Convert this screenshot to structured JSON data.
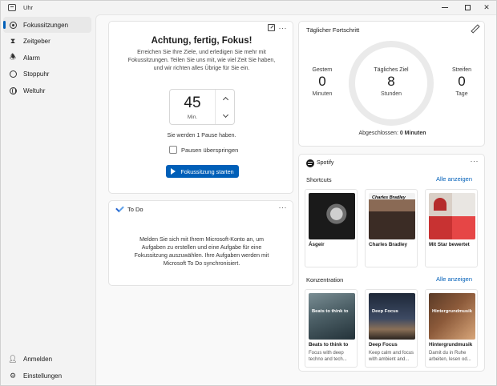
{
  "window": {
    "title": "Uhr",
    "icon": "clock-app-icon"
  },
  "sidebar": {
    "items": [
      {
        "label": "Fokussitzungen",
        "icon": "focus-icon",
        "active": true
      },
      {
        "label": "Zeitgeber",
        "icon": "hourglass-icon"
      },
      {
        "label": "Alarm",
        "icon": "bell-icon"
      },
      {
        "label": "Stoppuhr",
        "icon": "stopwatch-icon"
      },
      {
        "label": "Weltuhr",
        "icon": "globe-icon"
      }
    ],
    "bottom": [
      {
        "label": "Anmelden",
        "icon": "person-icon"
      },
      {
        "label": "Einstellungen",
        "icon": "gear-icon"
      }
    ]
  },
  "focus": {
    "title": "Achtung, fertig, Fokus!",
    "description": "Erreichen Sie Ihre Ziele, und erledigen Sie mehr mit Fokussitzungen. Teilen Sie uns mit, wie viel Zeit Sie haben, und wir richten alles Übrige für Sie ein.",
    "minutes": "45",
    "unit": "Min.",
    "pause_info": "Sie werden 1 Pause haben.",
    "skip_label": "Pausen überspringen",
    "start_label": "Fokussitzung starten",
    "more": "···"
  },
  "todo": {
    "title": "To Do",
    "message": "Melden Sie sich mit Ihrem Microsoft-Konto an, um Aufgaben zu erstellen und eine Aufgabe für eine Fokussitzung auszuwählen. Ihre Aufgaben werden mit Microsoft To Do synchronisiert.",
    "more": "···"
  },
  "progress": {
    "title": "Täglicher Fortschritt",
    "yesterday_label": "Gestern",
    "yesterday_value": "0",
    "yesterday_unit": "Minuten",
    "goal_label": "Tägliches Ziel",
    "goal_value": "8",
    "goal_unit": "Stunden",
    "streak_label": "Streifen",
    "streak_value": "0",
    "streak_unit": "Tage",
    "completed_label": "Abgeschlossen:",
    "completed_value": "0 Minuten"
  },
  "spotify": {
    "name": "Spotify",
    "more": "···",
    "sections": [
      {
        "title": "Shortcuts",
        "link": "Alle anzeigen",
        "tiles": [
          {
            "name": "Ásgeir",
            "desc": ""
          },
          {
            "name": "Charles Bradley",
            "desc": "",
            "art_text": "Charles Bradley"
          },
          {
            "name": "Mit Star bewertet",
            "desc": ""
          }
        ]
      },
      {
        "title": "Konzentration",
        "link": "Alle anzeigen",
        "tiles": [
          {
            "name": "Beats to think to",
            "desc": "Focus with deep techno and tech...",
            "art_text": "Beats to think to"
          },
          {
            "name": "Deep Focus",
            "desc": "Keep calm and focus with ambient and...",
            "art_text": "Deep Focus"
          },
          {
            "name": "Hintergrundmusik",
            "desc": "Damit du in Ruhe arbeiten, lesen od...",
            "art_text": "Hintergrundmusik"
          }
        ]
      }
    ]
  },
  "colors": {
    "accent": "#005fb8",
    "link": "#005fb8",
    "ring": "#eaeaea"
  }
}
